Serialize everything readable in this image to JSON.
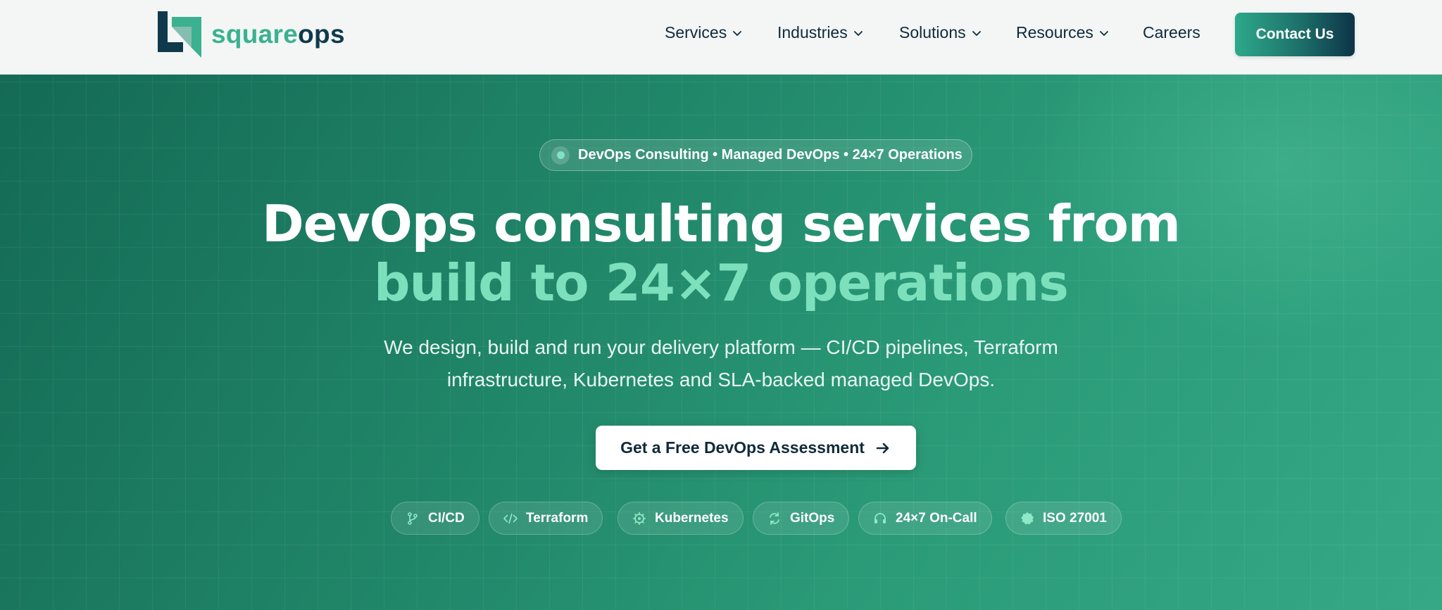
{
  "brand": {
    "name_part1": "square",
    "name_part2": "ops",
    "accent": "#3bb18f",
    "dark": "#0f3a4c"
  },
  "nav": {
    "items": [
      {
        "label": "Services",
        "dropdown": true
      },
      {
        "label": "Industries",
        "dropdown": true
      },
      {
        "label": "Solutions",
        "dropdown": true
      },
      {
        "label": "Resources",
        "dropdown": true
      },
      {
        "label": "Careers",
        "dropdown": false
      }
    ],
    "contact_label": "Contact Us"
  },
  "hero": {
    "pill_text": "DevOps Consulting • Managed DevOps • 24×7 Operations",
    "title_line1": "DevOps consulting services from",
    "title_line2": "build to 24×7 operations",
    "subtitle_line1": "We design, build and run your delivery platform — CI/CD pipelines, Terraform",
    "subtitle_line2": "infrastructure, Kubernetes and SLA-backed managed DevOps.",
    "cta_label": "Get a Free DevOps Assessment",
    "tags": [
      {
        "label": "CI/CD",
        "icon": "git-branch-icon"
      },
      {
        "label": "Terraform",
        "icon": "code-icon"
      },
      {
        "label": "Kubernetes",
        "icon": "helm-wheel-icon"
      },
      {
        "label": "GitOps",
        "icon": "sync-icon"
      },
      {
        "label": "24×7 On-Call",
        "icon": "headset-icon"
      },
      {
        "label": "ISO 27001",
        "icon": "badge-icon"
      }
    ],
    "colors": {
      "title_accent": "#7ce0bd",
      "bg_start": "#146a55",
      "bg_end": "#36a886"
    }
  }
}
